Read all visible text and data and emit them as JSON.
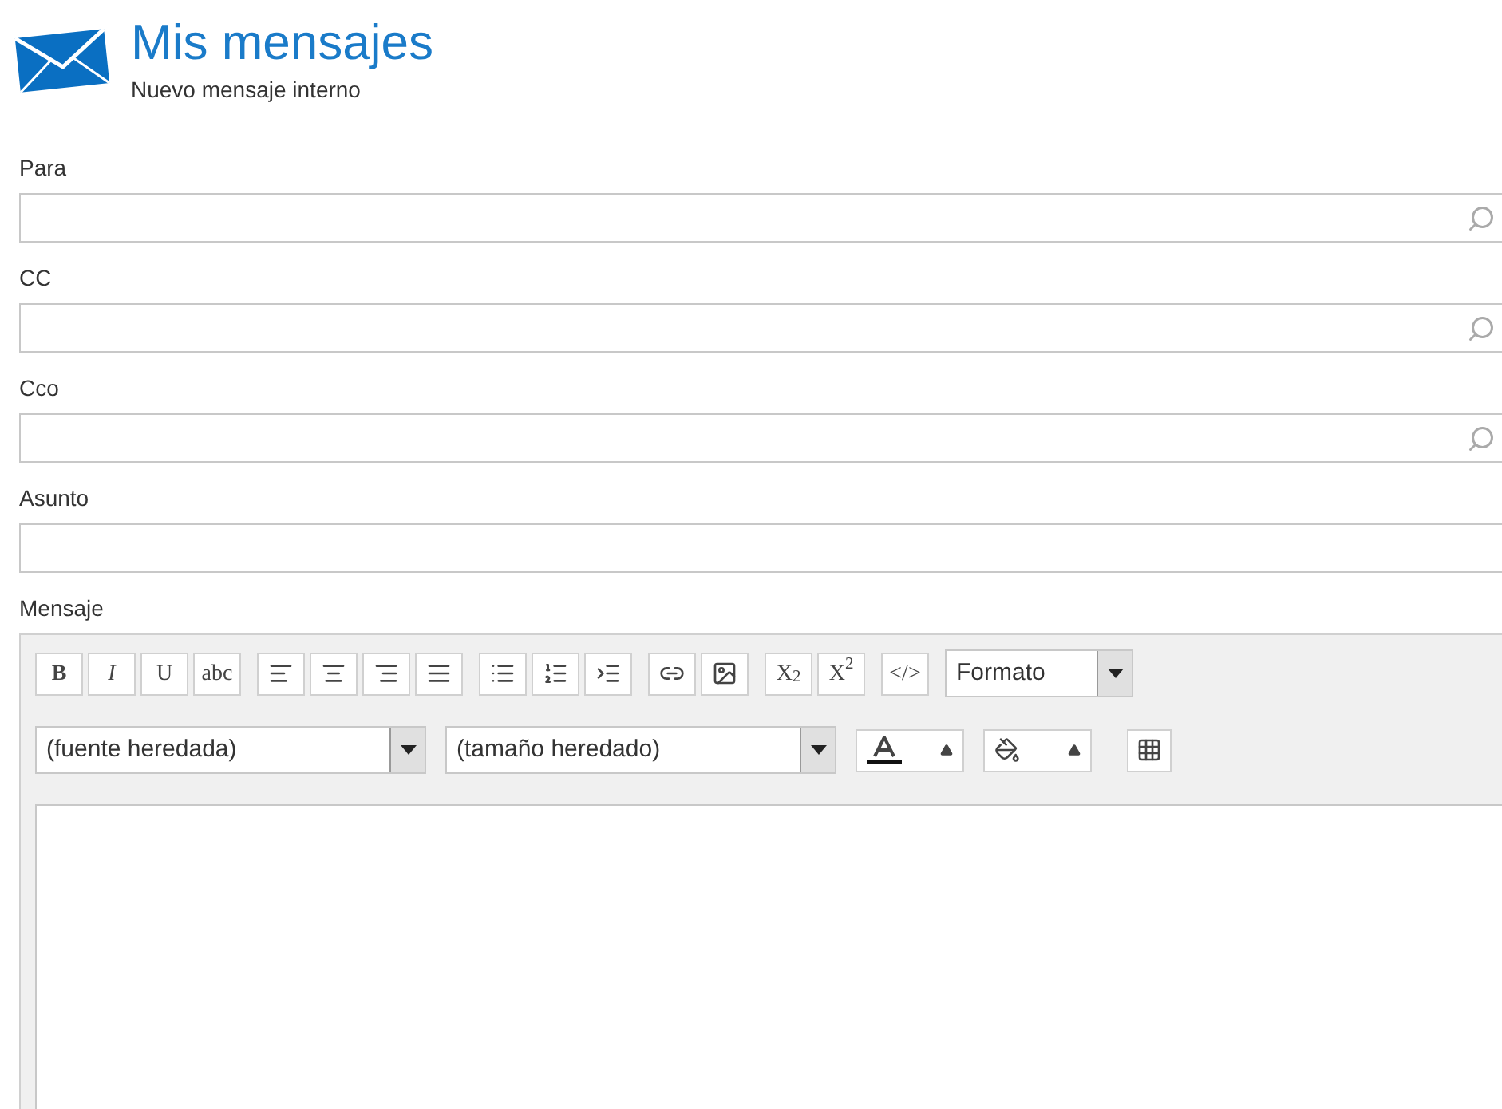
{
  "header": {
    "title": "Mis mensajes",
    "subtitle": "Nuevo mensaje interno"
  },
  "fields": [
    {
      "label": "Para",
      "kind": "lookup"
    },
    {
      "label": "CC",
      "kind": "lookup"
    },
    {
      "label": "Cco",
      "kind": "lookup"
    },
    {
      "label": "Asunto",
      "kind": "text"
    }
  ],
  "editor": {
    "label": "Mensaje",
    "toolbar_groups": [
      {
        "kind": "text",
        "items": [
          "**B**",
          "*I*",
          "U",
          "abc"
        ]
      },
      {
        "kind": "align"
      },
      {
        "kind": "list"
      },
      {
        "kind": "insert"
      },
      {
        "kind": "text",
        "items": [
          "X$_{2}$",
          "X$^{2}$"
        ]
      },
      {
        "kind": "text",
        "items": [
          "</>"
        ]
      }
    ],
    "format_select": "Formato",
    "font_select": "(fuente heredada)",
    "size_select": "(tamaño heredado)"
  }
}
